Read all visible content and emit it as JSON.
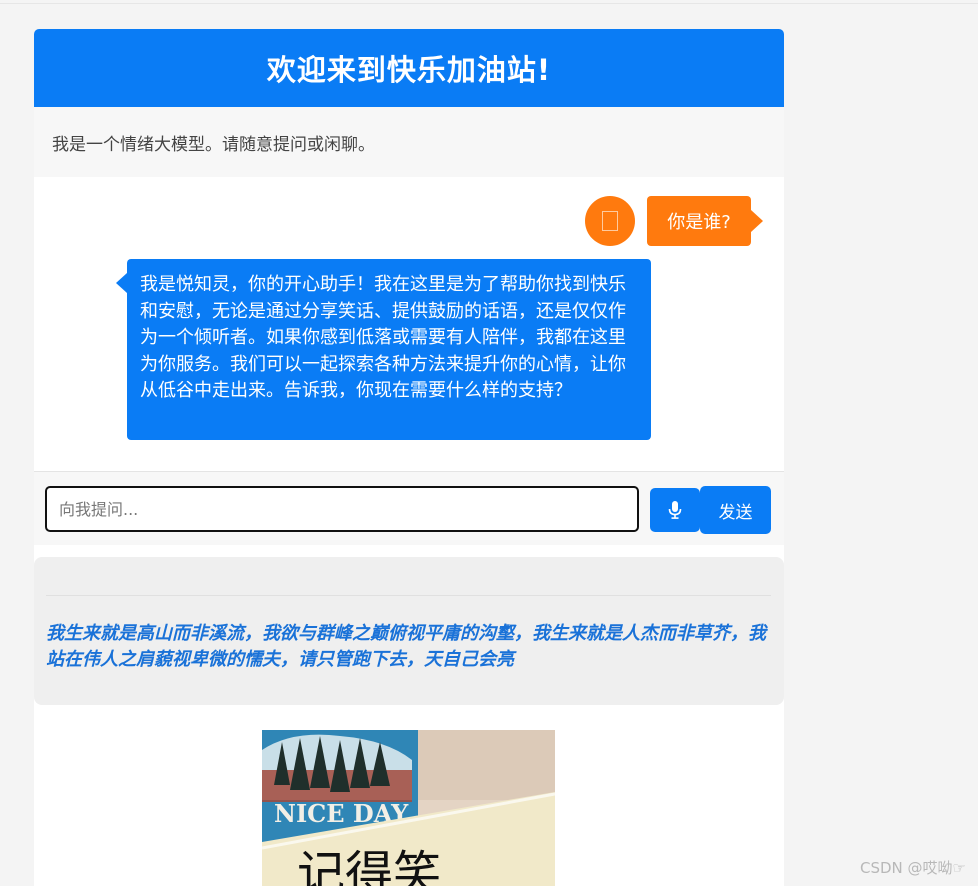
{
  "header": {
    "title": "欢迎来到快乐加油站!"
  },
  "intro": {
    "text": "我是一个情绪大模型。请随意提问或闲聊。"
  },
  "chat": {
    "messages": [
      {
        "role": "user",
        "text": "你是谁?"
      },
      {
        "role": "bot",
        "text": "我是悦知灵，你的开心助手！我在这里是为了帮助你找到快乐和安慰，无论是通过分享笑话、提供鼓励的话语，还是仅仅作为一个倾听者。如果你感到低落或需要有人陪伴，我都在这里为你服务。我们可以一起探索各种方法来提升你的心情，让你从低谷中走出来。告诉我，你现在需要什么样的支持？"
      }
    ]
  },
  "input": {
    "placeholder": "向我提问...",
    "value": ""
  },
  "buttons": {
    "send_label": "发送",
    "mic_icon": "microphone-icon"
  },
  "quote": {
    "text": "我生来就是高山而非溪流，我欲与群峰之巅俯视平庸的沟壑，我生来就是人杰而非草芥，我站在伟人之肩藐视卑微的懦夫，请只管跑下去，天自己会亮"
  },
  "image": {
    "label": "NICE DAY",
    "handwriting": "记得笑"
  },
  "watermark": {
    "text": "CSDN @哎呦☞"
  },
  "colors": {
    "primary": "#0a7cf5",
    "accent": "#ff7a0e",
    "quote": "#1a72d8"
  }
}
